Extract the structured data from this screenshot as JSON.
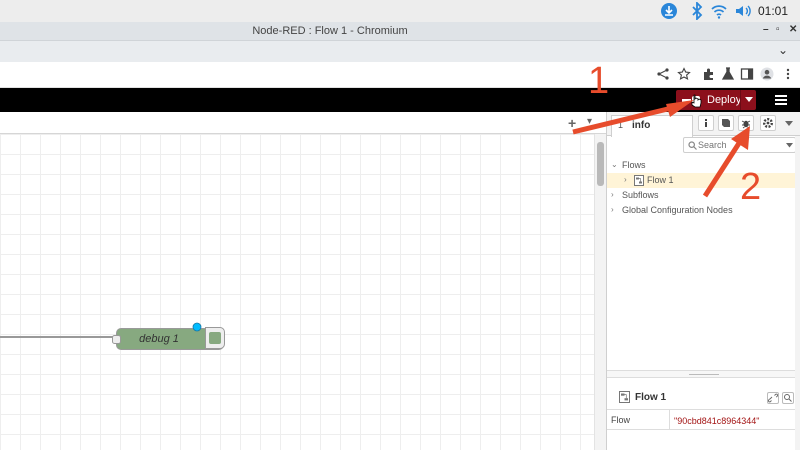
{
  "os_panel": {
    "clock": "01:01"
  },
  "window": {
    "title": "Node-RED : Flow 1 - Chromium",
    "min": "–",
    "max": "▫",
    "close": "✕",
    "expand": "⌄"
  },
  "header": {
    "deploy_label": "Deploy"
  },
  "workspace": {
    "add_flow": "+",
    "tab_menu": "▾"
  },
  "node": {
    "label": "debug 1"
  },
  "sidebar": {
    "tab_count": "1",
    "tab_label": "info",
    "search_placeholder": "Search",
    "tree": [
      {
        "chevron": "⌄",
        "label": "Flows"
      },
      {
        "chevron": "›",
        "label": "Flow 1"
      },
      {
        "chevron": "›",
        "label": "Subflows"
      },
      {
        "chevron": "›",
        "label": "Global Configuration Nodes"
      }
    ],
    "props": {
      "title": "Flow 1",
      "row_key": "Flow",
      "row_value": "\"90cbd841c8964344\""
    }
  },
  "annotations": {
    "one": "1",
    "two": "2"
  },
  "colors": {
    "accent": "#8c101c",
    "annotation": "#e74c2c",
    "node_green": "#87a980",
    "selected_row": "#fff4d7"
  }
}
